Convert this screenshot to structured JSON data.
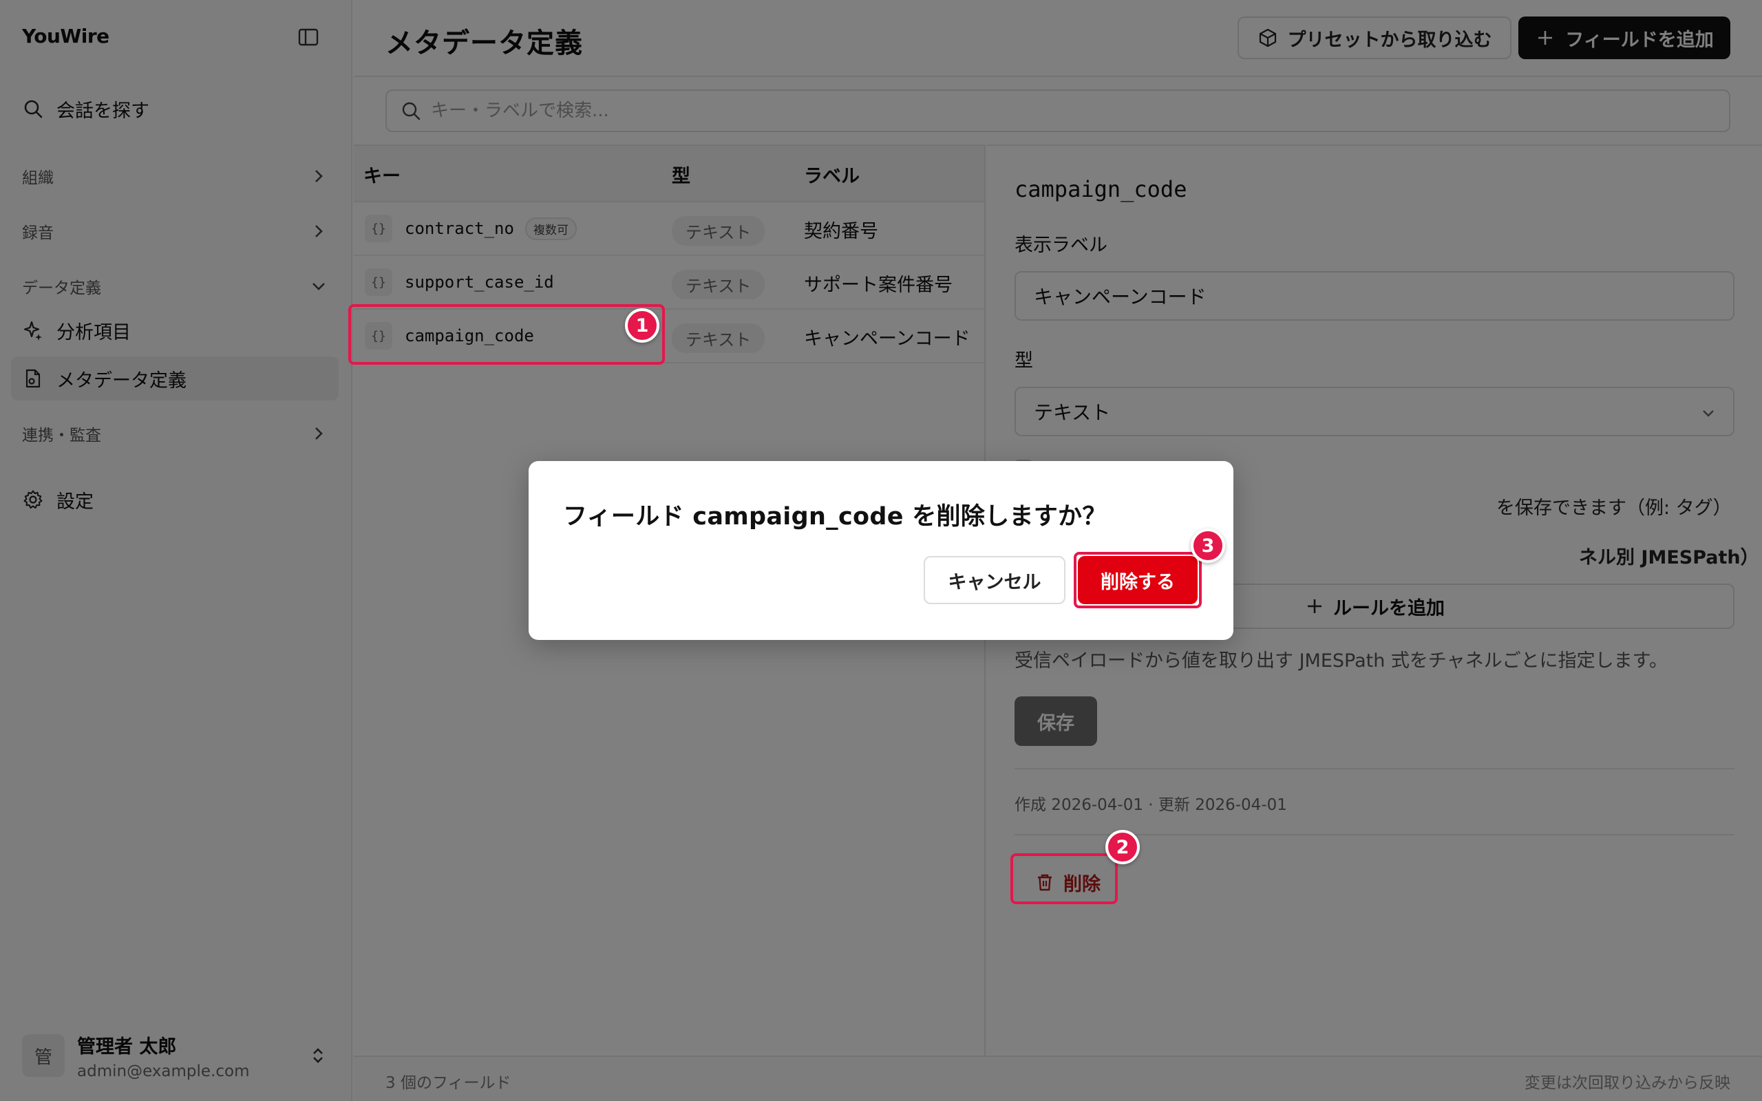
{
  "sidebar": {
    "brand": "YouWire",
    "search_label": "会話を探す",
    "groups": {
      "org": "組織",
      "recording": "録音",
      "data_def": "データ定義",
      "integration": "連携・監査"
    },
    "items": {
      "analysis": "分析項目",
      "metadata": "メタデータ定義",
      "settings": "設定"
    },
    "user": {
      "avatar": "管",
      "name": "管理者 太郎",
      "email": "admin@example.com"
    }
  },
  "header": {
    "title": "メタデータ定義",
    "preset_button": "プリセットから取り込む",
    "add_button": "フィールドを追加"
  },
  "search": {
    "placeholder": "キー・ラベルで検索..."
  },
  "table": {
    "columns": {
      "key": "キー",
      "type": "型",
      "label": "ラベル"
    },
    "key_icon": "{}",
    "rows": [
      {
        "key": "contract_no",
        "badge": "複数可",
        "type": "テキスト",
        "label": "契約番号"
      },
      {
        "key": "support_case_id",
        "badge": "",
        "type": "テキスト",
        "label": "サポート案件番号"
      },
      {
        "key": "campaign_code",
        "badge": "",
        "type": "テキスト",
        "label": "キャンペーンコード"
      }
    ]
  },
  "detail": {
    "key": "campaign_code",
    "display_label_title": "表示ラベル",
    "display_label_value": "キャンペーンコード",
    "type_title": "型",
    "type_value": "テキスト",
    "multi_hint_partial": "を保存できます（例: タグ）",
    "rules_title_partial": "ネル別 JMESPath）",
    "add_rule_button": "ルールを追加",
    "rule_hint": "受信ペイロードから値を取り出す JMESPath 式をチャネルごとに指定します。",
    "save_button": "保存",
    "meta": "作成 2026-04-01 · 更新 2026-04-01",
    "delete_button": "削除"
  },
  "footer": {
    "count": "3 個のフィールド",
    "note": "変更は次回取り込みから反映"
  },
  "modal": {
    "title": "フィールド campaign_code を削除しますか？",
    "cancel": "キャンセル",
    "confirm": "削除する"
  },
  "callouts": {
    "one": "1",
    "two": "2",
    "three": "3"
  },
  "colors": {
    "accent_red": "#e0000f",
    "callout": "#e5174b",
    "primary_dark": "#111111",
    "save_disabled": "#6d6d6d"
  }
}
